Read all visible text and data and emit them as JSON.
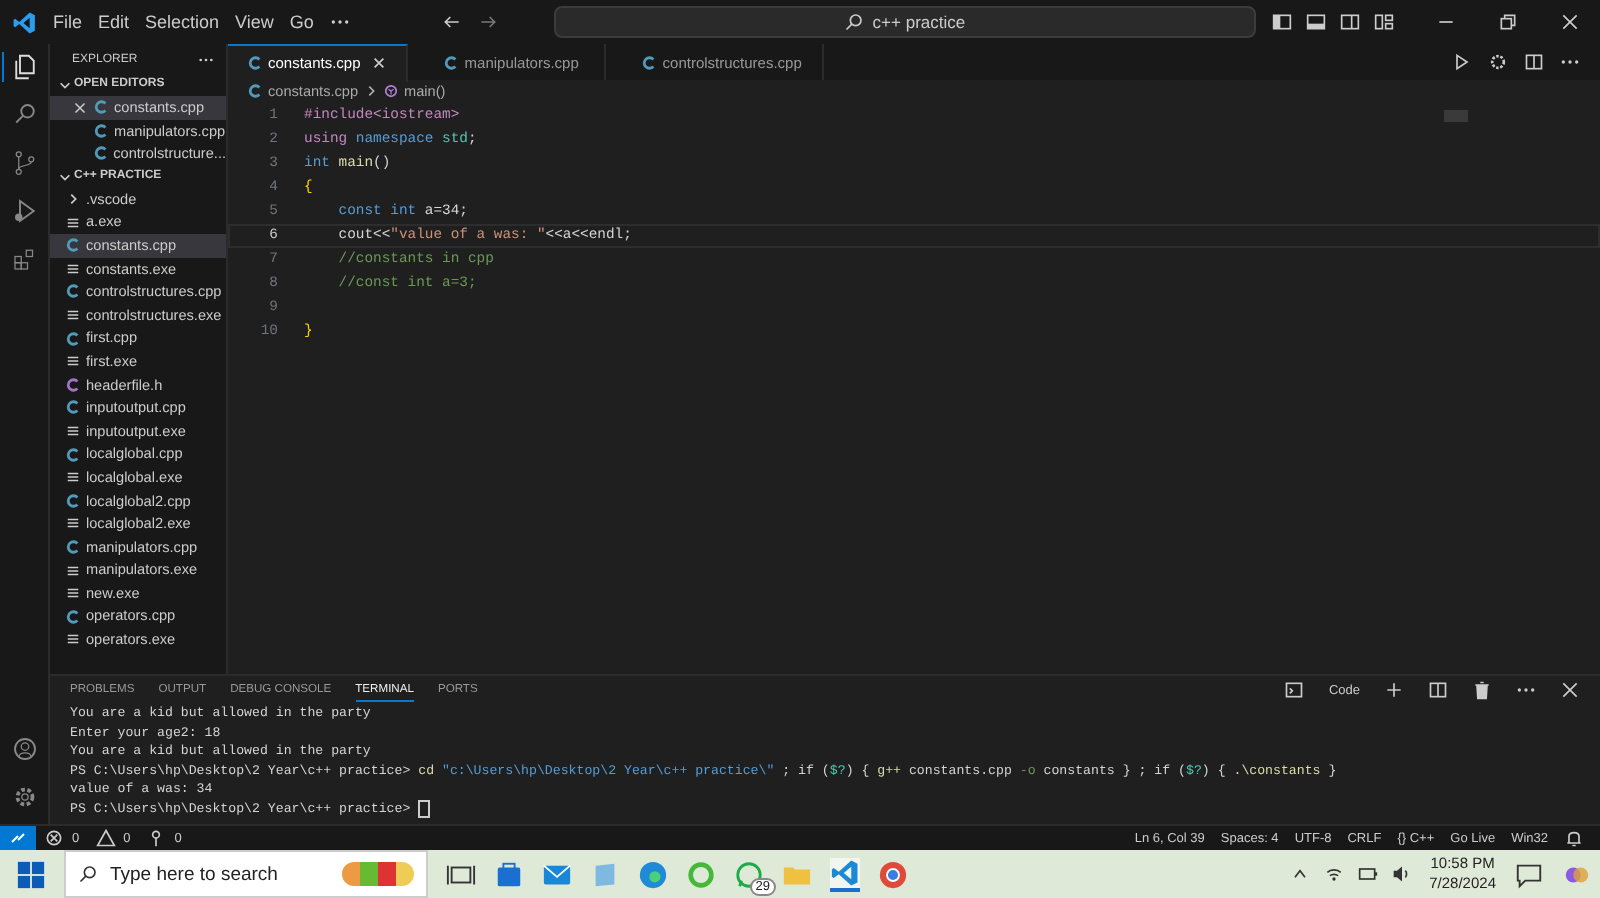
{
  "menu": [
    "File",
    "Edit",
    "Selection",
    "View",
    "Go"
  ],
  "search": {
    "value": "c++ practice"
  },
  "sidebar": {
    "title": "EXPLORER",
    "open_editors_title": "OPEN EDITORS",
    "open_editors": [
      {
        "name": "constants.cpp",
        "kind": "cpp",
        "selected": true
      },
      {
        "name": "manipulators.cpp",
        "kind": "cpp",
        "selected": false
      },
      {
        "name": "controlstructure...",
        "kind": "cpp",
        "selected": false
      }
    ],
    "folder_title": "C++ PRACTICE",
    "files": [
      {
        "name": ".vscode",
        "kind": "folder",
        "selected": false
      },
      {
        "name": "a.exe",
        "kind": "exe",
        "selected": false
      },
      {
        "name": "constants.cpp",
        "kind": "cpp",
        "selected": true
      },
      {
        "name": "constants.exe",
        "kind": "exe",
        "selected": false
      },
      {
        "name": "controlstructures.cpp",
        "kind": "cpp",
        "selected": false
      },
      {
        "name": "controlstructures.exe",
        "kind": "exe",
        "selected": false
      },
      {
        "name": "first.cpp",
        "kind": "cpp",
        "selected": false
      },
      {
        "name": "first.exe",
        "kind": "exe",
        "selected": false
      },
      {
        "name": "headerfile.h",
        "kind": "h",
        "selected": false
      },
      {
        "name": "inputoutput.cpp",
        "kind": "cpp",
        "selected": false
      },
      {
        "name": "inputoutput.exe",
        "kind": "exe",
        "selected": false
      },
      {
        "name": "localglobal.cpp",
        "kind": "cpp",
        "selected": false
      },
      {
        "name": "localglobal.exe",
        "kind": "exe",
        "selected": false
      },
      {
        "name": "localglobal2.cpp",
        "kind": "cpp",
        "selected": false
      },
      {
        "name": "localglobal2.exe",
        "kind": "exe",
        "selected": false
      },
      {
        "name": "manipulators.cpp",
        "kind": "cpp",
        "selected": false
      },
      {
        "name": "manipulators.exe",
        "kind": "exe",
        "selected": false
      },
      {
        "name": "new.exe",
        "kind": "exe",
        "selected": false
      },
      {
        "name": "operators.cpp",
        "kind": "cpp",
        "selected": false
      },
      {
        "name": "operators.exe",
        "kind": "exe",
        "selected": false
      }
    ]
  },
  "tabs": [
    {
      "label": "constants.cpp",
      "selected": true
    },
    {
      "label": "manipulators.cpp",
      "selected": false
    },
    {
      "label": "controlstructures.cpp",
      "selected": false
    }
  ],
  "breadcrumb": {
    "file": "constants.cpp",
    "symbol": "main()"
  },
  "code": [
    {
      "number": "1",
      "current": false,
      "tokens": [
        {
          "text": "#include<iostream>",
          "kind": "directive"
        }
      ]
    },
    {
      "number": "2",
      "current": false,
      "tokens": [
        {
          "text": "using ",
          "kind": "directive"
        },
        {
          "text": "namespace ",
          "kind": "keyword"
        },
        {
          "text": "std",
          "kind": "type"
        },
        {
          "text": ";",
          "kind": "plain"
        }
      ]
    },
    {
      "number": "3",
      "current": false,
      "tokens": [
        {
          "text": "int ",
          "kind": "keyword"
        },
        {
          "text": "main",
          "kind": "function"
        },
        {
          "text": "()",
          "kind": "plain"
        }
      ]
    },
    {
      "number": "4",
      "current": false,
      "tokens": [
        {
          "text": "{",
          "kind": "bracket"
        }
      ]
    },
    {
      "number": "5",
      "current": false,
      "tokens": [
        {
          "text": "    const int ",
          "kind": "keyword"
        },
        {
          "text": "a=34;",
          "kind": "plain"
        }
      ]
    },
    {
      "number": "6",
      "current": true,
      "tokens": [
        {
          "text": "    cout<<",
          "kind": "plain"
        },
        {
          "text": "\"value of a was: \"",
          "kind": "string"
        },
        {
          "text": "<<a<<endl;",
          "kind": "plain"
        }
      ]
    },
    {
      "number": "7",
      "current": false,
      "tokens": [
        {
          "text": "    //constants in cpp",
          "kind": "comment"
        }
      ]
    },
    {
      "number": "8",
      "current": false,
      "tokens": [
        {
          "text": "    //const int a=3;",
          "kind": "comment"
        }
      ]
    },
    {
      "number": "9",
      "current": false
    },
    {
      "number": "10",
      "current": false,
      "tokens": [
        {
          "text": "}",
          "kind": "bracket"
        }
      ]
    }
  ],
  "panel": {
    "tabs": [
      {
        "label": "PROBLEMS",
        "selected": false
      },
      {
        "label": "OUTPUT",
        "selected": false
      },
      {
        "label": "DEBUG CONSOLE",
        "selected": false
      },
      {
        "label": "TERMINAL",
        "selected": true
      },
      {
        "label": "PORTS",
        "selected": false
      }
    ],
    "shell": "Code",
    "terminal": [
      [
        {
          "text": "You are a kid but allowed in the party",
          "kind": "plain"
        }
      ],
      [
        {
          "text": "Enter your age2: 18",
          "kind": "plain"
        }
      ],
      [
        {
          "text": "You are a kid but allowed in the party",
          "kind": "plain"
        }
      ],
      [
        {
          "text": "PS C:\\Users\\hp\\Desktop\\2 Year\\c++ practice> ",
          "kind": "plain"
        },
        {
          "text": "cd ",
          "kind": "function"
        },
        {
          "text": "\"c:\\Users\\hp\\Desktop\\2 Year\\c++ practice\\\"",
          "kind": "keyword"
        },
        {
          "text": " ; if (",
          "kind": "plain"
        },
        {
          "text": "$?",
          "kind": "type"
        },
        {
          "text": ") { ",
          "kind": "plain"
        },
        {
          "text": "g++ ",
          "kind": "function"
        },
        {
          "text": "constants.cpp ",
          "kind": "plain"
        },
        {
          "text": "-o",
          "kind": "comment"
        },
        {
          "text": " constants } ; if (",
          "kind": "plain"
        },
        {
          "text": "$?",
          "kind": "type"
        },
        {
          "text": ") { ",
          "kind": "plain"
        },
        {
          "text": ".\\constants",
          "kind": "function"
        },
        {
          "text": " }",
          "kind": "plain"
        }
      ],
      [
        {
          "text": "value of a was: 34",
          "kind": "plain"
        }
      ],
      [
        {
          "text": "PS C:\\Users\\hp\\Desktop\\2 Year\\c++ practice> ",
          "kind": "plain"
        }
      ]
    ]
  },
  "status_bar": {
    "errors": "0",
    "warnings": "0",
    "ports": "0",
    "right": [
      "Ln 6, Col 39",
      "Spaces: 4",
      "UTF-8",
      "CRLF",
      "{} C++",
      "Go Live",
      "Win32"
    ]
  },
  "taskbar": {
    "search_placeholder": "Type here to search",
    "whatsapp_badge": "29",
    "time": "10:58 PM",
    "date": "7/28/2024"
  }
}
